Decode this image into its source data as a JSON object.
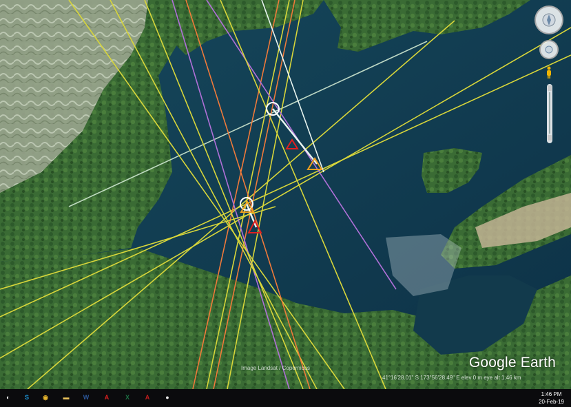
{
  "app": {
    "watermark": "Google Earth",
    "status_text": "Image Landsat / Copernicus",
    "coords_text": "41°16'28.01\" S 173°56'28.49\" E elev 0 m eye alt 1.46 km"
  },
  "navigation": {
    "compass_icon": "compass-ring",
    "look_icon": "look-joystick",
    "pegman_icon": "pegman",
    "zoom_icon": "zoom-slider"
  },
  "taskbar": {
    "apps": [
      {
        "name": "start",
        "glyph": "◐",
        "color": "#ffffff"
      },
      {
        "name": "skype",
        "glyph": "S",
        "color": "#1e9be0"
      },
      {
        "name": "chrome",
        "glyph": "◉",
        "color": "#e6b42c"
      },
      {
        "name": "file-explorer",
        "glyph": "▬",
        "color": "#e8c15a"
      },
      {
        "name": "word",
        "glyph": "W",
        "color": "#2b579a"
      },
      {
        "name": "acrobat",
        "glyph": "A",
        "color": "#d71f1f"
      },
      {
        "name": "excel",
        "glyph": "X",
        "color": "#1d7044"
      },
      {
        "name": "acrobat-reader",
        "glyph": "A",
        "color": "#c21d1d"
      },
      {
        "name": "google-earth",
        "glyph": "●",
        "color": "#e8e8e8"
      }
    ],
    "clock_time": "1:46 PM",
    "clock_date": "20-Feb-19"
  },
  "colors": {
    "water": "#113c52",
    "land": "#3c6a3a",
    "bearing_yellow": "#d8d63a",
    "bearing_orange": "#f07a3a",
    "bearing_purple": "#b070d8",
    "bearing_white": "#e8f4f0",
    "marker_red": "#e02020",
    "marker_orange": "#f0a020"
  }
}
